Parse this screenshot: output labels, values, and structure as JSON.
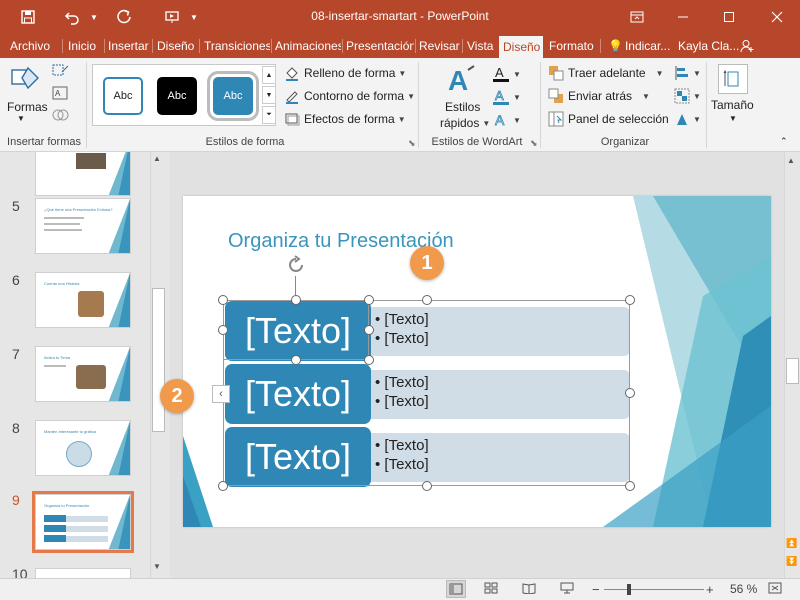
{
  "window": {
    "title": "08-insertar-smartart  -  PowerPoint",
    "titlebar_color": "#b7472a"
  },
  "quick_access": [
    {
      "icon": "save-icon"
    },
    {
      "icon": "undo-icon"
    },
    {
      "icon": "redo-icon"
    },
    {
      "icon": "present-icon"
    }
  ],
  "tabs": [
    "Archivo",
    "Inicio",
    "Insertar",
    "Diseño",
    "Transiciones",
    "Animaciones",
    "Presentación",
    "Revisar",
    "Vista",
    "Diseño",
    "Formato"
  ],
  "active_tab_index": 9,
  "tell_me": "Indicar...",
  "user": "Kayla Cla...",
  "ribbon": {
    "formas_label": "Formas",
    "insertar_formas_label": "Insertar formas",
    "abc": [
      "Abc",
      "Abc",
      "Abc"
    ],
    "relleno": "Relleno de forma",
    "contorno": "Contorno de forma",
    "efectos": "Efectos de forma",
    "estilos_forma_label": "Estilos de forma",
    "estilos_rapidos_1": "Estilos",
    "estilos_rapidos_2": "rápidos",
    "estilos_wordart_label": "Estilos de WordArt",
    "traer": "Traer adelante",
    "enviar": "Enviar atrás",
    "panel": "Panel de selección",
    "organizar_label": "Organizar",
    "tamano": "Tamaño"
  },
  "thumbnails": [
    {
      "num": "5",
      "title": "¿Qué tiene una Presentación Exitosa?"
    },
    {
      "num": "6",
      "title": "Cuenta una Historia"
    },
    {
      "num": "7",
      "title": "Ilustra tu Tema"
    },
    {
      "num": "8",
      "title": "Mantén Interesante tu gráfica"
    },
    {
      "num": "9",
      "title": "Organiza tu Presentación"
    },
    {
      "num": "10",
      "title": ""
    }
  ],
  "slide": {
    "title": "Organiza tu Presentación",
    "rows": [
      {
        "label": "[Texto]",
        "bullets": [
          "• [Texto]",
          "• [Texto]"
        ]
      },
      {
        "label": "[Texto]",
        "bullets": [
          "• [Texto]",
          "• [Texto]"
        ]
      },
      {
        "label": "[Texto]",
        "bullets": [
          "• [Texto]",
          "• [Texto]"
        ]
      }
    ],
    "callouts": [
      "1",
      "2"
    ]
  },
  "status": {
    "zoom": "56 %"
  },
  "colors": {
    "accent": "#b7472a",
    "smartart_dark": "#2f87b6",
    "smartart_light": "#d1dde6",
    "callout": "#f19a4b",
    "selected_thumb": "#e5794a"
  }
}
